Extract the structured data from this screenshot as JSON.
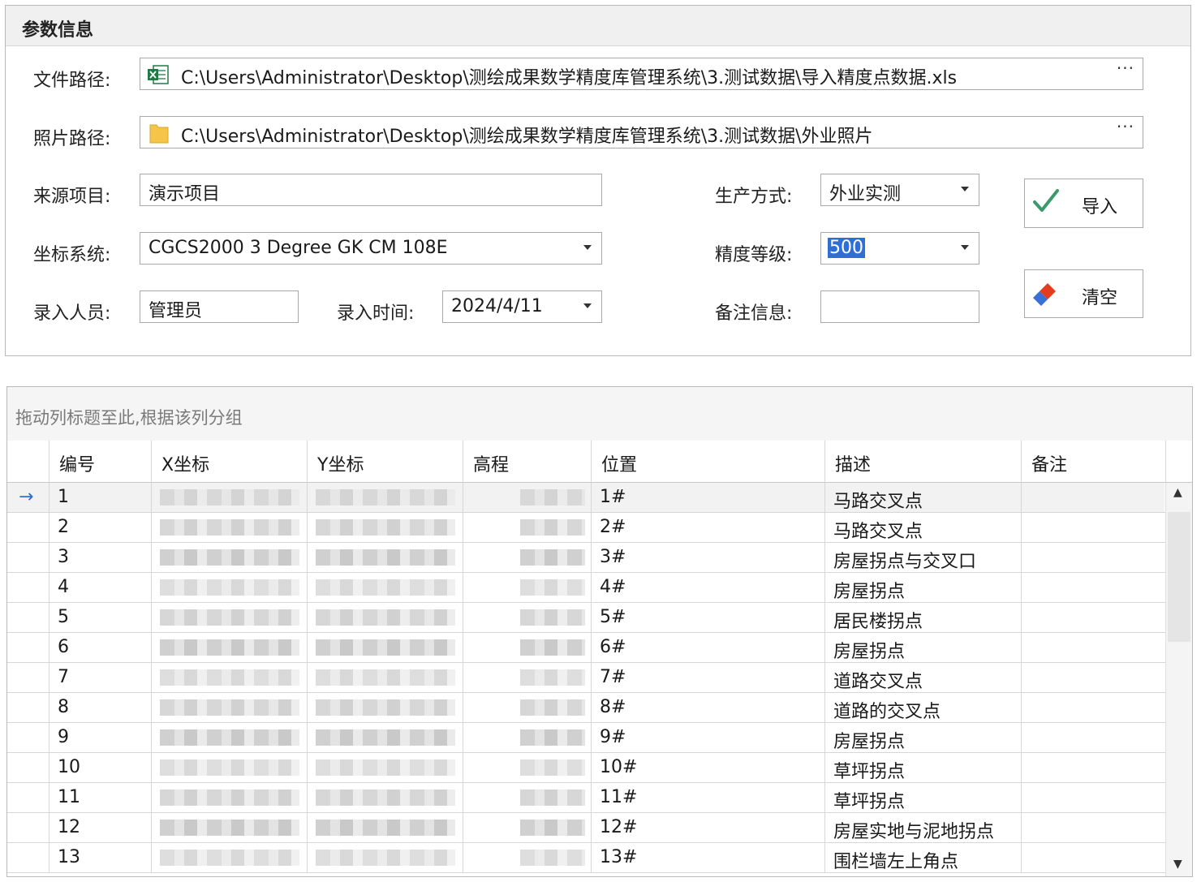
{
  "panel": {
    "title": "参数信息",
    "file_path_label": "文件路径:",
    "file_path_value": "C:\\Users\\Administrator\\Desktop\\测绘成果数学精度库管理系统\\3.测试数据\\导入精度点数据.xls",
    "photo_path_label": "照片路径:",
    "photo_path_value": "C:\\Users\\Administrator\\Desktop\\测绘成果数学精度库管理系统\\3.测试数据\\外业照片",
    "browse_label": "···",
    "source_project_label": "来源项目:",
    "source_project_value": "演示项目",
    "production_mode_label": "生产方式:",
    "production_mode_value": "外业实测",
    "coord_system_label": "坐标系统:",
    "coord_system_value": "CGCS2000 3 Degree GK CM 108E",
    "precision_level_label": "精度等级:",
    "precision_level_value": "500",
    "entry_person_label": "录入人员:",
    "entry_person_value": "管理员",
    "entry_time_label": "录入时间:",
    "entry_time_value": "2024/4/11",
    "remarks_label": "备注信息:",
    "remarks_value": "",
    "import_button": "导入",
    "clear_button": "清空"
  },
  "grid": {
    "group_hint": "拖动列标题至此,根据该列分组",
    "columns": [
      "编号",
      "X坐标",
      "Y坐标",
      "高程",
      "位置",
      "描述",
      "备注"
    ],
    "current_row_indicator": "→",
    "rows": [
      {
        "id": "1",
        "pos": "1#",
        "desc": "马路交叉点",
        "note": ""
      },
      {
        "id": "2",
        "pos": "2#",
        "desc": "马路交叉点",
        "note": ""
      },
      {
        "id": "3",
        "pos": "3#",
        "desc": "房屋拐点与交叉口",
        "note": ""
      },
      {
        "id": "4",
        "pos": "4#",
        "desc": "房屋拐点",
        "note": ""
      },
      {
        "id": "5",
        "pos": "5#",
        "desc": "居民楼拐点",
        "note": ""
      },
      {
        "id": "6",
        "pos": "6#",
        "desc": "房屋拐点",
        "note": ""
      },
      {
        "id": "7",
        "pos": "7#",
        "desc": "道路交叉点",
        "note": ""
      },
      {
        "id": "8",
        "pos": "8#",
        "desc": "道路的交叉点",
        "note": ""
      },
      {
        "id": "9",
        "pos": "9#",
        "desc": "房屋拐点",
        "note": ""
      },
      {
        "id": "10",
        "pos": "10#",
        "desc": "草坪拐点",
        "note": ""
      },
      {
        "id": "11",
        "pos": "11#",
        "desc": "草坪拐点",
        "note": ""
      },
      {
        "id": "12",
        "pos": "12#",
        "desc": "房屋实地与泥地拐点",
        "note": ""
      },
      {
        "id": "13",
        "pos": "13#",
        "desc": "围栏墙左上角点",
        "note": ""
      }
    ]
  },
  "icons": {
    "excel": "excel-file-icon",
    "folder": "folder-icon",
    "check": "check-icon",
    "eraser": "eraser-icon",
    "dropdown": "chevron-down-icon"
  },
  "colors": {
    "selection": "#2f6ed2",
    "check": "#3a9a6a",
    "eraser_red": "#e43c1f",
    "eraser_blue": "#3b6fd8",
    "excel_green": "#1f7a45",
    "folder_yellow": "#f5c54a"
  }
}
